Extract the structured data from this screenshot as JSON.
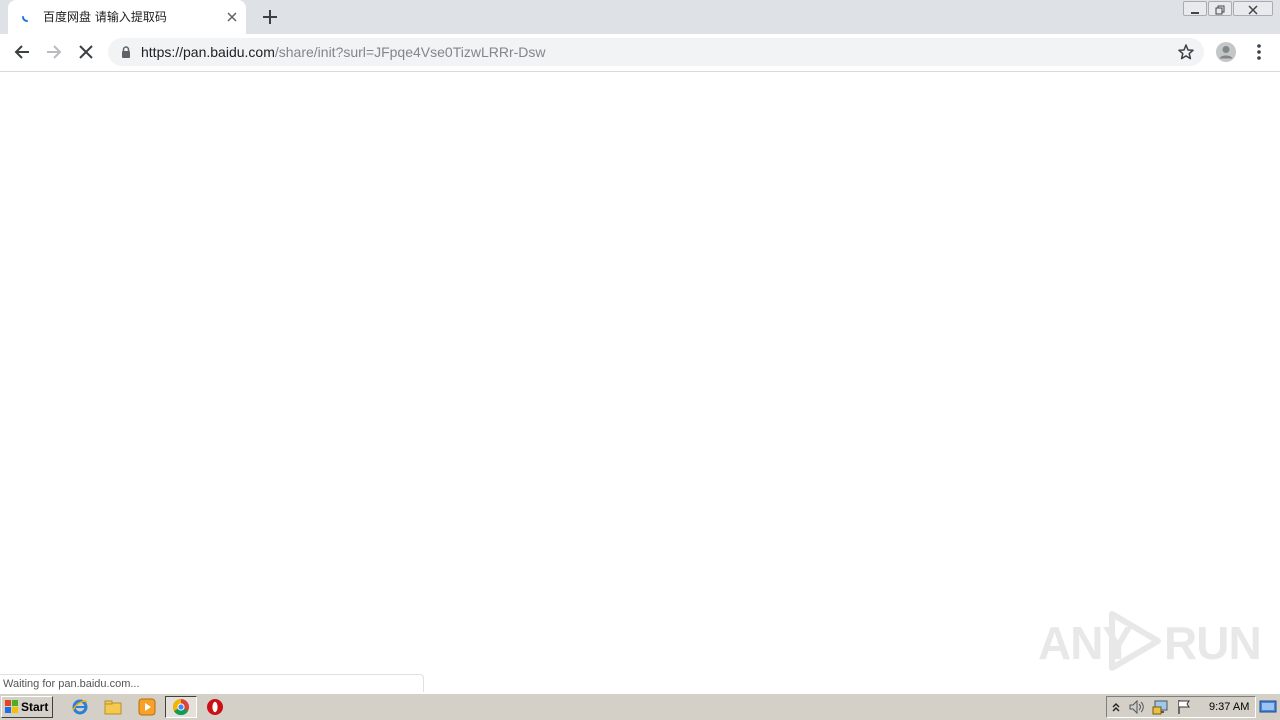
{
  "browser": {
    "tab": {
      "title": "百度网盘 请输入提取码",
      "favicon": "loading-spinner-icon"
    },
    "new_tab_icon": "plus-icon",
    "window_controls": [
      "minimize-icon",
      "restore-icon",
      "close-icon"
    ],
    "toolbar": {
      "back_icon": "arrow-left-icon",
      "forward_icon": "arrow-right-icon",
      "stop_icon": "close-icon"
    },
    "address": {
      "scheme_host": "https://pan.baidu.com",
      "path": "/share/init?surl=JFpqe4Vse0TizwLRRr-Dsw",
      "secure_icon": "lock-icon"
    },
    "bookmark_icon": "star-outline-icon",
    "profile_icon": "avatar-icon",
    "menu_icon": "more-vertical-icon",
    "status": "Waiting for pan.baidu.com..."
  },
  "watermark": {
    "left": "ANY",
    "right": "RUN"
  },
  "taskbar": {
    "start_label": "Start",
    "pinned": [
      "internet-explorer-icon",
      "file-explorer-icon",
      "media-player-icon",
      "chrome-icon",
      "opera-icon"
    ],
    "tray_icons": [
      "chevron-up-icon",
      "speaker-icon",
      "network-icon",
      "flag-icon"
    ],
    "clock": "9:37 AM",
    "show_desktop_icon": "show-desktop-icon"
  },
  "colors": {
    "tabstrip": "#dee1e6",
    "omnibox": "#f1f3f4",
    "taskbar": "#d4d0c8",
    "accent_blue": "#1a73e8"
  }
}
